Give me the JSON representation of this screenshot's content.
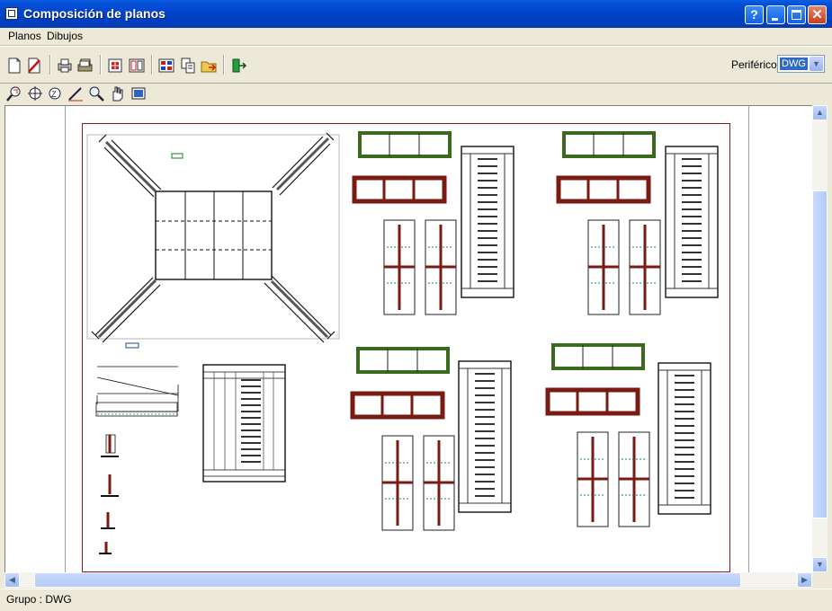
{
  "window": {
    "title": "Composición de planos",
    "buttons": {
      "help": "?",
      "minimize": "_",
      "maximize": "□",
      "close": "✕"
    }
  },
  "menu": {
    "items": [
      "Planos",
      "Dibujos"
    ]
  },
  "toolbar": {
    "periferico_label": "Periférico",
    "periferico_value": "DWG",
    "icons": [
      "new-document-icon",
      "delete-icon",
      "print-icon",
      "print-all-icon",
      "insert-drawing-icon",
      "arrange-icon",
      "layout-icon",
      "copy-icon",
      "export-icon",
      "exit-icon"
    ]
  },
  "toolbar2": {
    "icons": [
      "zoom-window-icon",
      "zoom-fit-icon",
      "zoom-previous-icon",
      "measure-icon",
      "zoom-icon",
      "pan-icon",
      "redraw-icon"
    ]
  },
  "drawing": {
    "thumbnail_label": "",
    "sheet_colors": {
      "frame": "#8a1a1a",
      "green_beam": "#3a6a1e",
      "red_beam": "#7a1a12",
      "text": "#1a7a7a"
    }
  },
  "status": {
    "text": "Grupo : DWG"
  }
}
